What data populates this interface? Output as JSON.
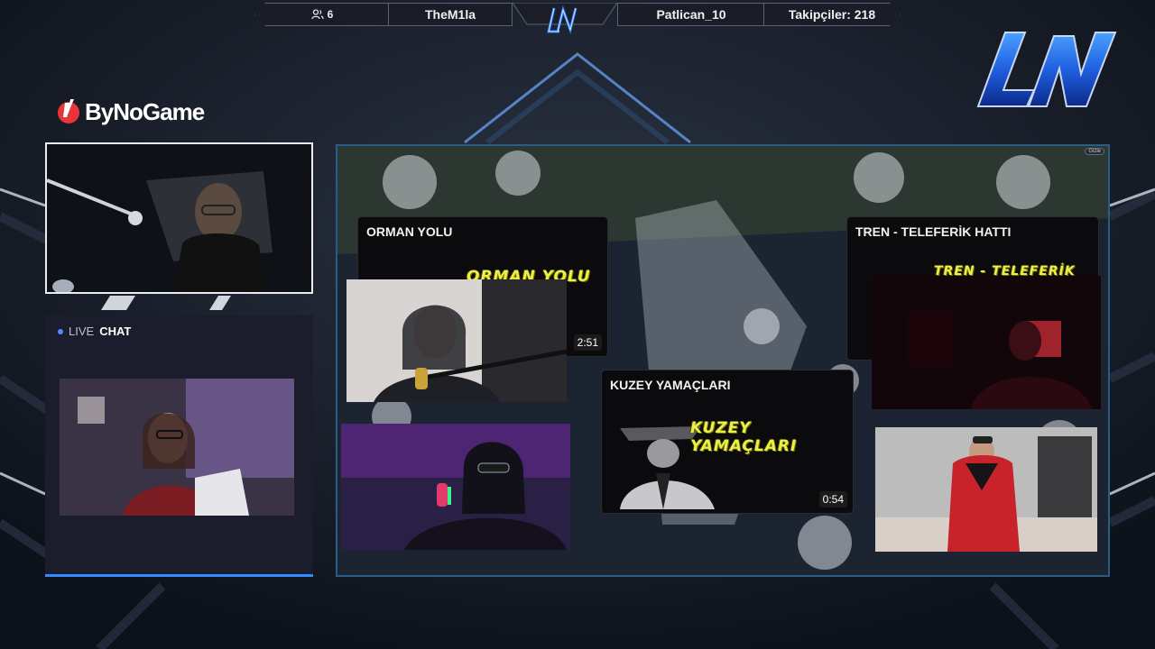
{
  "topbar": {
    "viewers": "6",
    "user_left": "TheM1la",
    "user_right": "Patlican_10",
    "followers": "Takipçiler: 218"
  },
  "sponsor": {
    "name": "ByNoGame"
  },
  "chat": {
    "live_label": "LIVE",
    "chat_label": "CHAT"
  },
  "stage": {
    "hide_badge": "Gizle",
    "cards": [
      {
        "title": "ORMAN YOLU",
        "thumb_text": "ORMAN YOLU",
        "duration": "2:51"
      },
      {
        "title": "TREN - TELEFERİK HATTI",
        "thumb_text": "TREN - TELEFERİK HATTI",
        "duration": ""
      },
      {
        "title": "KUZEY YAMAÇLARI",
        "thumb_text": "KUZEY YAMAÇLARI",
        "duration": "0:54"
      }
    ]
  },
  "colors": {
    "accent_blue": "#2e8cff",
    "thumb_yellow": "#e8f04a",
    "stage_border": "#2a5d86"
  },
  "icons": [
    "viewers-icon",
    "bynogame-logo-icon",
    "ln-logo-icon",
    "live-dot-icon"
  ]
}
